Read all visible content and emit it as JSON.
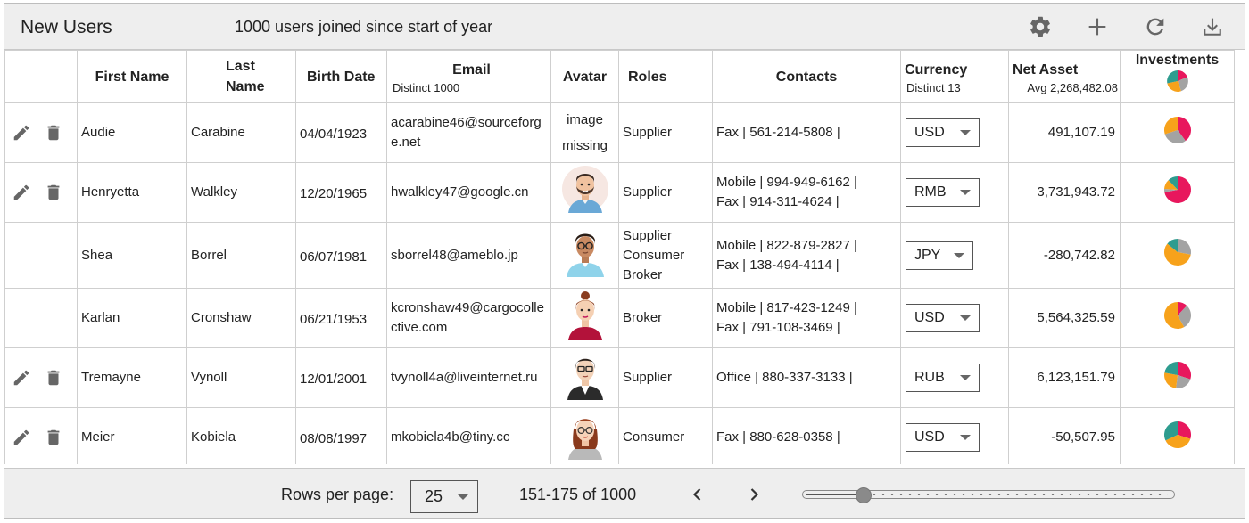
{
  "toolbar": {
    "title": "New Users",
    "subtitle": "1000 users joined since start of year",
    "icons": [
      "gear-icon",
      "plus-icon",
      "refresh-icon",
      "download-icon"
    ]
  },
  "columns": {
    "first_name": "First Name",
    "last_name": "Last Name",
    "birth_date": "Birth Date",
    "email": "Email",
    "email_sub": "Distinct 1000",
    "avatar": "Avatar",
    "roles": "Roles",
    "contacts": "Contacts",
    "currency": "Currency",
    "currency_sub": "Distinct 13",
    "net_asset": "Net Asset",
    "net_asset_sub": "Avg 2,268,482.08",
    "investments": "Investments"
  },
  "colors": {
    "pink": "#e8175d",
    "teal": "#2e9c8f",
    "orange": "#f7a21b",
    "gray": "#a3a3a3"
  },
  "rows": [
    {
      "editable": true,
      "first_name": "Audie",
      "last_name": "Carabine",
      "birth_date": "04/04/1923",
      "email": "acarabine46@sourceforge.net",
      "avatar": "missing",
      "avatar_text": "image missing",
      "roles": [
        "Supplier"
      ],
      "contacts": [
        "Fax | 561-214-5808 |"
      ],
      "currency": "USD",
      "net_asset": "491,107.19",
      "investments": [
        0.4,
        0.3,
        0.3,
        0
      ]
    },
    {
      "editable": true,
      "first_name": "Henryetta",
      "last_name": "Walkley",
      "birth_date": "12/20/1965",
      "email": "hwalkley47@google.cn",
      "avatar": "man-beard",
      "roles": [
        "Supplier"
      ],
      "contacts": [
        "Mobile | 994-949-6162 |",
        "Fax | 914-311-4624 |"
      ],
      "currency": "RMB",
      "net_asset": "3,731,943.72",
      "investments": [
        0.72,
        0.04,
        0.12,
        0.12
      ]
    },
    {
      "editable": false,
      "first_name": "Shea",
      "last_name": "Borrel",
      "birth_date": "06/07/1981",
      "email": "sborrel48@ameblo.jp",
      "avatar": "man-glasses",
      "roles": [
        "Supplier",
        "Consumer",
        "Broker"
      ],
      "contacts": [
        "Mobile | 822-879-2827 |",
        "Fax | 138-494-4114 |"
      ],
      "currency": "JPY",
      "net_asset": "-280,742.82",
      "investments": [
        0.0,
        0.28,
        0.58,
        0.14
      ]
    },
    {
      "editable": false,
      "first_name": "Karlan",
      "last_name": "Cronshaw",
      "birth_date": "06/21/1953",
      "email": "kcronshaw49@cargocollective.com",
      "avatar": "woman-bun",
      "roles": [
        "Broker"
      ],
      "contacts": [
        "Mobile | 817-423-1249 |",
        "Fax | 791-108-3469 |"
      ],
      "currency": "USD",
      "net_asset": "5,564,325.59",
      "investments": [
        0.12,
        0.3,
        0.58,
        0.0
      ]
    },
    {
      "editable": true,
      "first_name": "Tremayne",
      "last_name": "Vynoll",
      "birth_date": "12/01/2001",
      "email": "tvynoll4a@liveinternet.ru",
      "avatar": "woman-glasses",
      "roles": [
        "Supplier"
      ],
      "contacts": [
        "Office | 880-337-3133 |"
      ],
      "currency": "RUB",
      "net_asset": "6,123,151.79",
      "investments": [
        0.3,
        0.22,
        0.26,
        0.22
      ]
    },
    {
      "editable": true,
      "first_name": "Meier",
      "last_name": "Kobiela",
      "birth_date": "08/08/1997",
      "email": "mkobiela4b@tiny.cc",
      "avatar": "woman-redhead",
      "roles": [
        "Consumer"
      ],
      "contacts": [
        "Fax | 880-628-0358 |"
      ],
      "currency": "USD",
      "net_asset": "-50,507.95",
      "investments": [
        0.3,
        0.0,
        0.38,
        0.32
      ]
    }
  ],
  "footer": {
    "rows_per_page_label": "Rows per page:",
    "rows_per_page_value": "25",
    "range_text": "151-175 of 1000",
    "slider_position": 0.15
  }
}
